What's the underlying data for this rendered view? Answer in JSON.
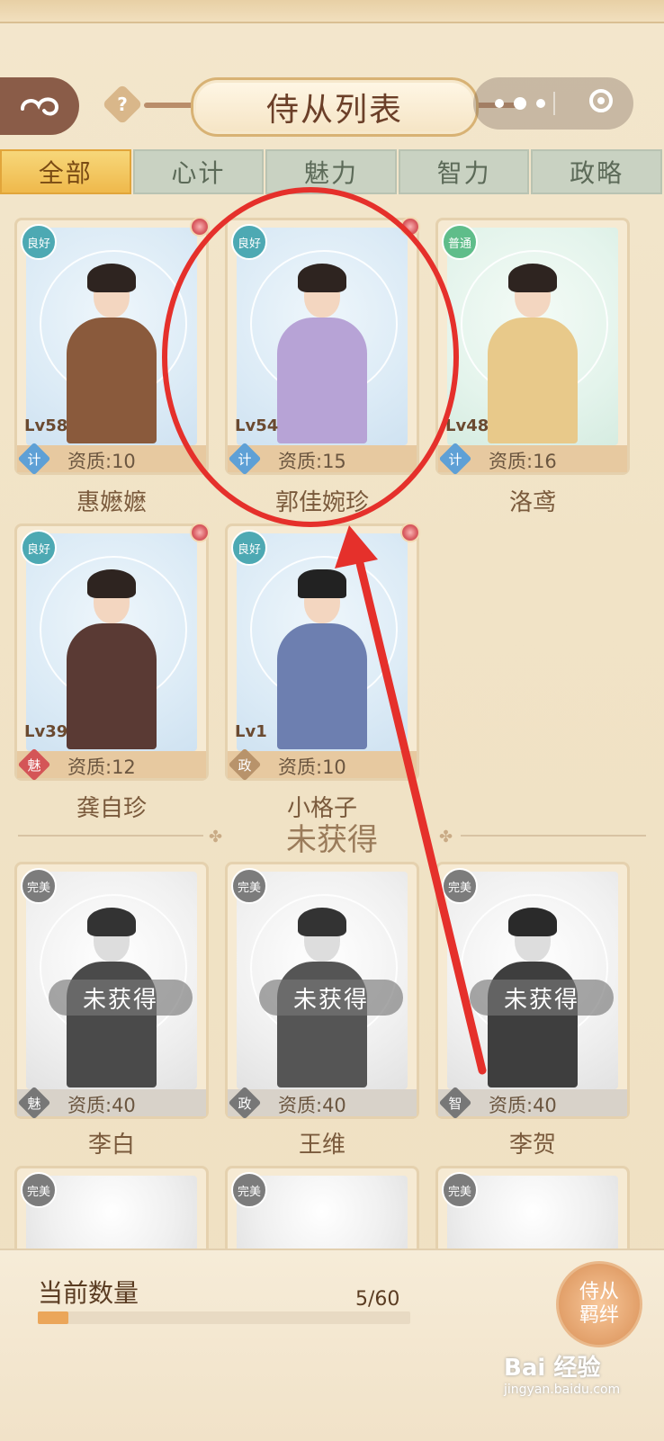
{
  "header": {
    "title": "侍从列表",
    "help_label": "?"
  },
  "tabs": [
    "全部",
    "心计",
    "魅力",
    "智力",
    "政略"
  ],
  "owned": [
    {
      "name": "惠嬷嬷",
      "level": "Lv58",
      "grade": "资质:10",
      "badge": "良好",
      "type_char": "计",
      "type_color": "blue"
    },
    {
      "name": "郭佳婉珍",
      "level": "Lv54",
      "grade": "资质:15",
      "badge": "良好",
      "type_char": "计",
      "type_color": "blue"
    },
    {
      "name": "洛鸢",
      "level": "Lv48",
      "grade": "资质:16",
      "badge": "普通",
      "type_char": "计",
      "type_color": "blue"
    },
    {
      "name": "龚自珍",
      "level": "Lv39",
      "grade": "资质:12",
      "badge": "良好",
      "type_char": "魅",
      "type_color": "red"
    },
    {
      "name": "小格子",
      "level": "Lv1",
      "grade": "资质:10",
      "badge": "良好",
      "type_char": "政",
      "type_color": "tan"
    }
  ],
  "section_unowned": "未获得",
  "unowned": [
    {
      "name": "李白",
      "grade": "资质:40",
      "badge": "完美",
      "type_char": "魅",
      "overlay": "未获得"
    },
    {
      "name": "王维",
      "grade": "资质:40",
      "badge": "完美",
      "type_char": "政",
      "overlay": "未获得"
    },
    {
      "name": "李贺",
      "grade": "资质:40",
      "badge": "完美",
      "type_char": "智",
      "overlay": "未获得"
    }
  ],
  "partial_badges": [
    "完美",
    "完美",
    "完美"
  ],
  "footer": {
    "count_label": "当前数量",
    "count_value": "5/60",
    "progress_fraction": 0.0833,
    "seal_line1": "侍从",
    "seal_line2": "羁绊"
  },
  "watermark": {
    "brand": "Bai 经验",
    "url": "jingyan.baidu.com"
  },
  "colors": {
    "accent": "#efb94c",
    "annotation": "#e5302b"
  }
}
